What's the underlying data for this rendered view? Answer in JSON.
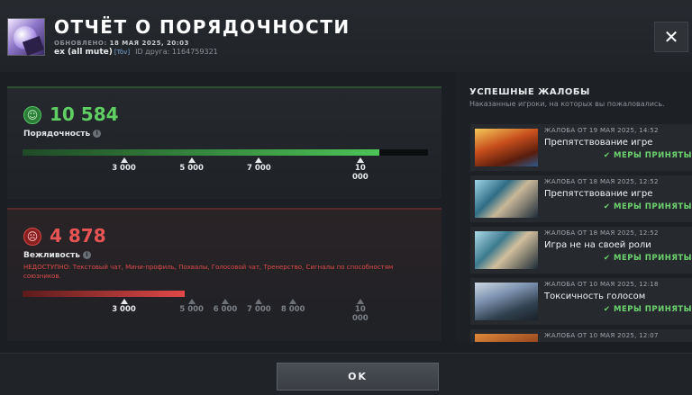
{
  "header": {
    "title": "ОТЧЁТ О ПОРЯДОЧНОСТИ",
    "updated_label": "ОБНОВЛЕНО:",
    "updated_value": "18 МАЯ 2025, 20:03",
    "player_name": "ex (all mute)",
    "player_tag": "[Töv]",
    "friend_id": "ID друга: 1164759321",
    "close_glyph": "✕"
  },
  "conduct": {
    "icon_glyph": "☺",
    "value": "10 584",
    "label": "Порядочность",
    "info_glyph": "i",
    "bar_fraction": 0.88,
    "ticks": [
      {
        "label": "3 000",
        "fraction": 0.25
      },
      {
        "label": "5 000",
        "fraction": 0.417
      },
      {
        "label": "7 000",
        "fraction": 0.583
      },
      {
        "label": "10\n000",
        "fraction": 0.833
      }
    ]
  },
  "behavior": {
    "icon_glyph": "☹",
    "value": "4 878",
    "label": "Вежливость",
    "info_glyph": "i",
    "unavailable": "НЕДОСТУПНО: Текстовый чат, Мини-профиль, Похвалы, Голосовой чат, Тренерство, Сигналы по способностям союзников.",
    "bar_fraction": 0.4,
    "ticks": [
      {
        "label": "3 000",
        "fraction": 0.25,
        "dim": false
      },
      {
        "label": "5 000",
        "fraction": 0.417,
        "dim": true
      },
      {
        "label": "6 000",
        "fraction": 0.5,
        "dim": true
      },
      {
        "label": "7 000",
        "fraction": 0.583,
        "dim": true
      },
      {
        "label": "8 000",
        "fraction": 0.667,
        "dim": true
      },
      {
        "label": "10\n000",
        "fraction": 0.833,
        "dim": true
      }
    ]
  },
  "reports": {
    "title": "УСПЕШНЫЕ ЖАЛОБЫ",
    "subtitle": "Наказанные игроки, на которых вы пожаловались.",
    "items": [
      {
        "meta": "ЖАЛОБА ОТ 19 МАЯ 2025, 14:52",
        "reason": "Препятствование игре",
        "status": "✔ МЕРЫ ПРИНЯТЫ"
      },
      {
        "meta": "ЖАЛОБА ОТ 18 МАЯ 2025, 12:52",
        "reason": "Препятствование игре",
        "status": "✔ МЕРЫ ПРИНЯТЫ"
      },
      {
        "meta": "ЖАЛОБА ОТ 18 МАЯ 2025, 12:52",
        "reason": "Игра не на своей роли",
        "status": "✔ МЕРЫ ПРИНЯТЫ"
      },
      {
        "meta": "ЖАЛОБА ОТ 10 МАЯ 2025, 12:18",
        "reason": "Токсичность голосом",
        "status": "✔ МЕРЫ ПРИНЯТЫ"
      },
      {
        "meta": "ЖАЛОБА ОТ 10 МАЯ 2025, 12:07",
        "reason": "",
        "status": ""
      }
    ]
  },
  "footer": {
    "ok_label": "OK"
  }
}
